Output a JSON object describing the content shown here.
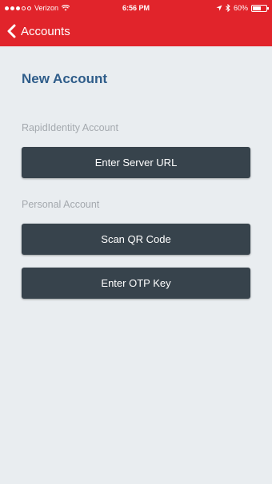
{
  "status_bar": {
    "carrier": "Verizon",
    "time": "6:56 PM",
    "battery": "60%",
    "battery_level": 0.6,
    "signal_icon": "signal-dots-icon",
    "wifi_icon": "wifi-icon",
    "location_icon": "location-arrow-icon",
    "bluetooth_icon": "bluetooth-icon",
    "battery_icon": "battery-icon"
  },
  "nav": {
    "back_label": "Accounts",
    "back_icon": "chevron-left-icon",
    "color": "#e1242b"
  },
  "main": {
    "title": "New Account",
    "sections": [
      {
        "label": "RapidIdentity Account",
        "buttons": [
          {
            "label": "Enter Server URL"
          }
        ]
      },
      {
        "label": "Personal Account",
        "buttons": [
          {
            "label": "Scan QR Code"
          },
          {
            "label": "Enter OTP Key"
          }
        ]
      }
    ]
  },
  "colors": {
    "accent": "#e1242b",
    "title": "#2f5d8a",
    "button": "#37434c",
    "background": "#e9edf0",
    "section_label": "#a4a9ae"
  }
}
